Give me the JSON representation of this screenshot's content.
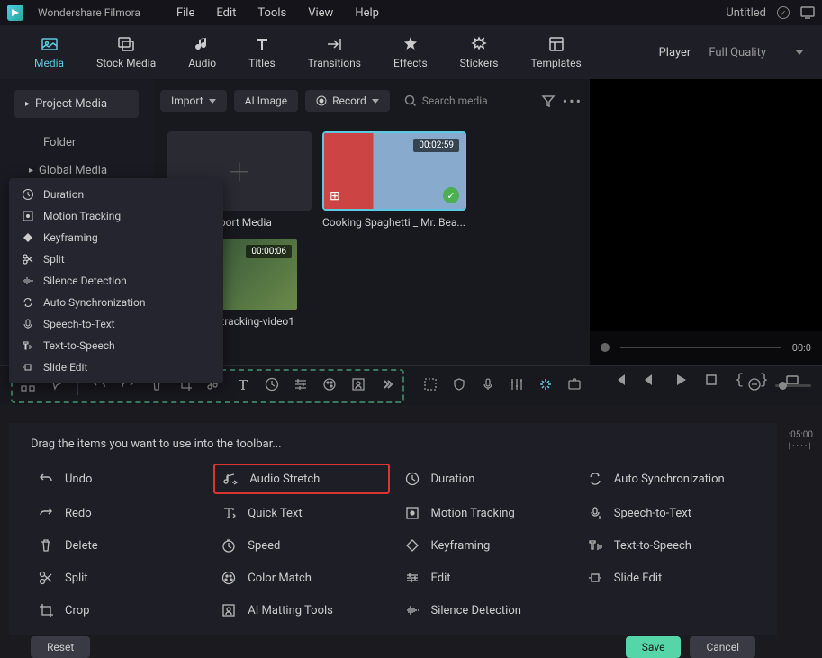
{
  "titlebar": {
    "app_name": "Wondershare Filmora",
    "menus": [
      "File",
      "Edit",
      "Tools",
      "View",
      "Help"
    ],
    "doc_name": "Untitled"
  },
  "main_tabs": [
    {
      "label": "Media",
      "active": true
    },
    {
      "label": "Stock Media"
    },
    {
      "label": "Audio"
    },
    {
      "label": "Titles"
    },
    {
      "label": "Transitions"
    },
    {
      "label": "Effects"
    },
    {
      "label": "Stickers"
    },
    {
      "label": "Templates"
    }
  ],
  "player": {
    "label": "Player",
    "quality": "Full Quality"
  },
  "sidebar": {
    "project_btn": "Project Media",
    "folder": "Folder",
    "global": "Global Media"
  },
  "media_toolbar": {
    "import": "Import",
    "ai_image": "AI Image",
    "record": "Record",
    "search_placeholder": "Search media"
  },
  "media_items": [
    {
      "label": "Import Media",
      "type": "add"
    },
    {
      "label": "Cooking Spaghetti _ Mr. Bea...",
      "time": "00:02:59",
      "type": "video"
    },
    {
      "label": "-tracking-video1",
      "time": "00:00:06",
      "type": "video2"
    }
  ],
  "context_menu": [
    "Duration",
    "Motion Tracking",
    "Keyframing",
    "Split",
    "Silence Detection",
    "Auto Synchronization",
    "Speech-to-Text",
    "Text-to-Speech",
    "Slide Edit"
  ],
  "preview": {
    "time": "00:0"
  },
  "customize": {
    "title": "Drag the items you want to use into the toolbar...",
    "items": [
      {
        "label": "Undo",
        "icon": "undo"
      },
      {
        "label": "Audio Stretch",
        "icon": "audio-stretch",
        "highlighted": true
      },
      {
        "label": "Duration",
        "icon": "duration"
      },
      {
        "label": "Auto Synchronization",
        "icon": "sync"
      },
      {
        "label": "Redo",
        "icon": "redo"
      },
      {
        "label": "Quick Text",
        "icon": "text"
      },
      {
        "label": "Motion Tracking",
        "icon": "tracking"
      },
      {
        "label": "Speech-to-Text",
        "icon": "stt"
      },
      {
        "label": "Delete",
        "icon": "delete"
      },
      {
        "label": "Speed",
        "icon": "speed"
      },
      {
        "label": "Keyframing",
        "icon": "keyframe"
      },
      {
        "label": "Text-to-Speech",
        "icon": "tts"
      },
      {
        "label": "Split",
        "icon": "split"
      },
      {
        "label": "Color Match",
        "icon": "color"
      },
      {
        "label": "Edit",
        "icon": "edit"
      },
      {
        "label": "Slide Edit",
        "icon": "slide"
      },
      {
        "label": "Crop",
        "icon": "crop"
      },
      {
        "label": "AI Matting Tools",
        "icon": "ai-matting"
      },
      {
        "label": "Silence Detection",
        "icon": "silence"
      }
    ],
    "reset": "Reset",
    "save": "Save",
    "cancel": "Cancel"
  },
  "timeline_scale": ":05:00"
}
